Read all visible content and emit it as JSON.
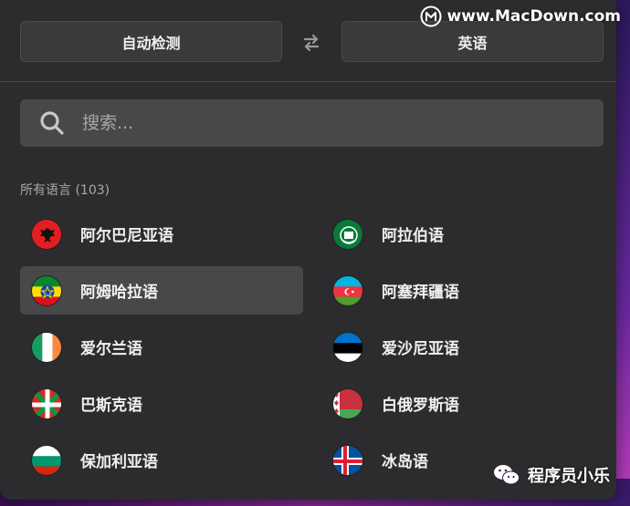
{
  "header": {
    "source_language": "自动检测",
    "target_language": "英语"
  },
  "search": {
    "placeholder": "搜索..."
  },
  "list": {
    "section_title": "所有语言 (103)",
    "items": [
      {
        "label": "阿尔巴尼亚语",
        "flag": "albania-flag",
        "column": 0,
        "row": 0,
        "selected": false
      },
      {
        "label": "阿拉伯语",
        "flag": "arab-league-flag",
        "column": 1,
        "row": 0,
        "selected": false
      },
      {
        "label": "阿姆哈拉语",
        "flag": "ethiopia-flag",
        "column": 0,
        "row": 1,
        "selected": true
      },
      {
        "label": "阿塞拜疆语",
        "flag": "azerbaijan-flag",
        "column": 1,
        "row": 1,
        "selected": false
      },
      {
        "label": "爱尔兰语",
        "flag": "ireland-flag",
        "column": 0,
        "row": 2,
        "selected": false
      },
      {
        "label": "爱沙尼亚语",
        "flag": "estonia-flag",
        "column": 1,
        "row": 2,
        "selected": false
      },
      {
        "label": "巴斯克语",
        "flag": "basque-flag",
        "column": 0,
        "row": 3,
        "selected": false
      },
      {
        "label": "白俄罗斯语",
        "flag": "belarus-flag",
        "column": 1,
        "row": 3,
        "selected": false
      },
      {
        "label": "保加利亚语",
        "flag": "bulgaria-flag",
        "column": 0,
        "row": 4,
        "selected": false
      },
      {
        "label": "冰岛语",
        "flag": "iceland-flag",
        "column": 1,
        "row": 4,
        "selected": false
      }
    ]
  },
  "overlays": {
    "watermark": "www.MacDown.com",
    "wechat_account": "程序员小乐"
  },
  "colors": {
    "panel_bg": "#2c2c2e",
    "button_bg": "#3a3a3c",
    "selected_bg": "#48484a",
    "text": "#f0f0f0",
    "muted_text": "#a8a8aa"
  }
}
